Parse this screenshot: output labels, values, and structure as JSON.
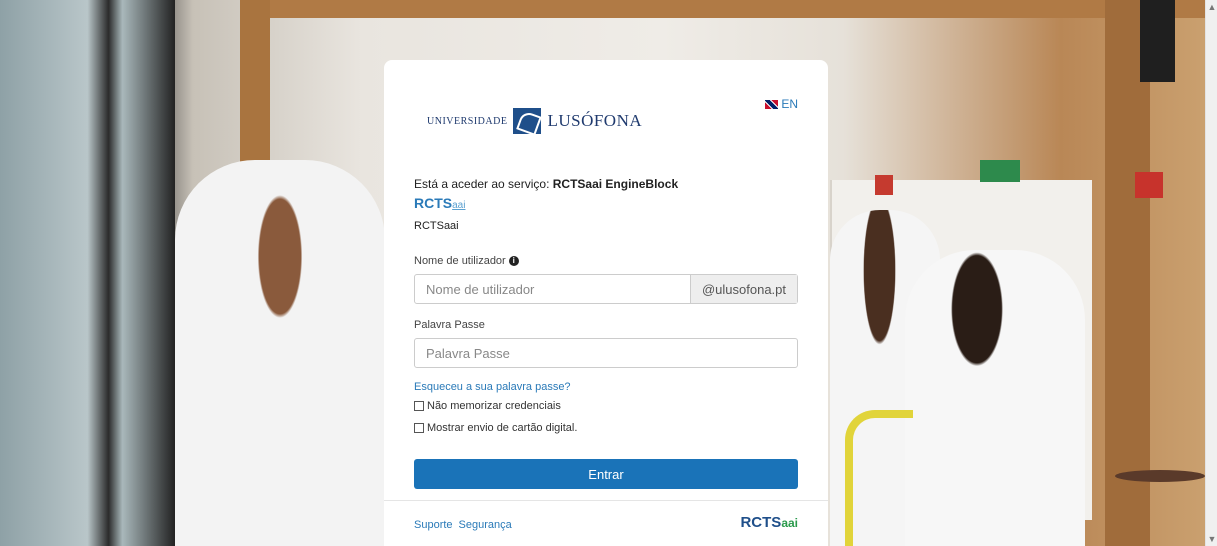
{
  "lang": {
    "label": "EN"
  },
  "logo": {
    "prefix": "UNIVERSIDADE",
    "name": "LUSÓFONA"
  },
  "service": {
    "intro": "Está a aceder ao serviço:",
    "name": "RCTSaai EngineBlock",
    "logo_main": "RCTS",
    "logo_sub": "aai",
    "display_name": "RCTSaai"
  },
  "form": {
    "username_label": "Nome de utilizador",
    "username_placeholder": "Nome de utilizador",
    "username_value": "",
    "domain_suffix": "@ulusofona.pt",
    "password_label": "Palavra Passe",
    "password_placeholder": "Palavra Passe",
    "password_value": "",
    "forgot_link": "Esqueceu a sua palavra passe?",
    "remember_label": "Não memorizar credenciais",
    "remember_checked": false,
    "digital_card_label": "Mostrar envio de cartão digital.",
    "digital_card_checked": false,
    "submit_label": "Entrar"
  },
  "footer": {
    "links": [
      "Suporte",
      "Segurança"
    ],
    "logo_main": "RCTS",
    "logo_sub": "aai"
  },
  "colors": {
    "primary": "#1a73b8",
    "link": "#2a7ab8",
    "brand": "#1f3a6e"
  },
  "icons": {
    "info": "info-circle-icon",
    "flag": "uk-flag-icon",
    "scroll_up": "chevron-up-icon",
    "scroll_down": "chevron-down-icon"
  }
}
